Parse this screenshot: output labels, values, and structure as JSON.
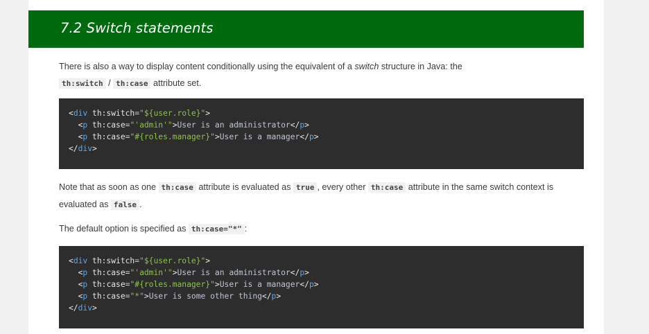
{
  "section": {
    "title": "7.2 Switch statements"
  },
  "para1": {
    "text_a": "There is also a way to display content conditionally using the equivalent of a ",
    "emph": "switch",
    "text_b": " structure in Java: the",
    "code_a": "th:switch",
    "sep": " / ",
    "code_b": "th:case",
    "text_c": " attribute set."
  },
  "code1": [
    [
      [
        "tag",
        "<"
      ],
      [
        "tagname",
        "div"
      ],
      [
        "attr",
        " th:switch"
      ],
      [
        "eq",
        "="
      ],
      [
        "str",
        "\"${user.role}\""
      ],
      [
        "tag",
        ">"
      ]
    ],
    [
      [
        "inner",
        "  "
      ],
      [
        "tag",
        "<"
      ],
      [
        "tagname",
        "p"
      ],
      [
        "attr",
        " th:case"
      ],
      [
        "eq",
        "="
      ],
      [
        "str",
        "\"'admin'\""
      ],
      [
        "tag",
        ">"
      ],
      [
        "inner",
        "User is an administrator"
      ],
      [
        "tag",
        "</"
      ],
      [
        "tagname",
        "p"
      ],
      [
        "tag",
        ">"
      ]
    ],
    [
      [
        "inner",
        "  "
      ],
      [
        "tag",
        "<"
      ],
      [
        "tagname",
        "p"
      ],
      [
        "attr",
        " th:case"
      ],
      [
        "eq",
        "="
      ],
      [
        "str",
        "\"#{roles.manager}\""
      ],
      [
        "tag",
        ">"
      ],
      [
        "inner",
        "User is a manager"
      ],
      [
        "tag",
        "</"
      ],
      [
        "tagname",
        "p"
      ],
      [
        "tag",
        ">"
      ]
    ],
    [
      [
        "tag",
        "</"
      ],
      [
        "tagname",
        "div"
      ],
      [
        "tag",
        ">"
      ]
    ]
  ],
  "para2": {
    "text_a": "Note that as soon as one ",
    "code_a": "th:case",
    "text_b": " attribute is evaluated as ",
    "code_b": "true",
    "text_c": ", every other ",
    "code_c": "th:case",
    "text_d": " attribute in the same switch context is evaluated as ",
    "code_d": "false",
    "text_e": "."
  },
  "para3": {
    "text_a": "The default option is specified as ",
    "code_a": "th:case=\"*\"",
    "text_b": ":"
  },
  "code2": [
    [
      [
        "tag",
        "<"
      ],
      [
        "tagname",
        "div"
      ],
      [
        "attr",
        " th:switch"
      ],
      [
        "eq",
        "="
      ],
      [
        "str",
        "\"${user.role}\""
      ],
      [
        "tag",
        ">"
      ]
    ],
    [
      [
        "inner",
        "  "
      ],
      [
        "tag",
        "<"
      ],
      [
        "tagname",
        "p"
      ],
      [
        "attr",
        " th:case"
      ],
      [
        "eq",
        "="
      ],
      [
        "str",
        "\"'admin'\""
      ],
      [
        "tag",
        ">"
      ],
      [
        "inner",
        "User is an administrator"
      ],
      [
        "tag",
        "</"
      ],
      [
        "tagname",
        "p"
      ],
      [
        "tag",
        ">"
      ]
    ],
    [
      [
        "inner",
        "  "
      ],
      [
        "tag",
        "<"
      ],
      [
        "tagname",
        "p"
      ],
      [
        "attr",
        " th:case"
      ],
      [
        "eq",
        "="
      ],
      [
        "str",
        "\"#{roles.manager}\""
      ],
      [
        "tag",
        ">"
      ],
      [
        "inner",
        "User is a manager"
      ],
      [
        "tag",
        "</"
      ],
      [
        "tagname",
        "p"
      ],
      [
        "tag",
        ">"
      ]
    ],
    [
      [
        "inner",
        "  "
      ],
      [
        "tag",
        "<"
      ],
      [
        "tagname",
        "p"
      ],
      [
        "attr",
        " th:case"
      ],
      [
        "eq",
        "="
      ],
      [
        "str",
        "\"*\""
      ],
      [
        "tag",
        ">"
      ],
      [
        "inner",
        "User is some other thing"
      ],
      [
        "tag",
        "</"
      ],
      [
        "tagname",
        "p"
      ],
      [
        "tag",
        ">"
      ]
    ],
    [
      [
        "tag",
        "</"
      ],
      [
        "tagname",
        "div"
      ],
      [
        "tag",
        ">"
      ]
    ]
  ],
  "colors": {
    "header_bg": "#006b0e",
    "code_bg": "#2d2d2d",
    "string": "#8fc24a",
    "tagname": "#5fa9e8"
  }
}
